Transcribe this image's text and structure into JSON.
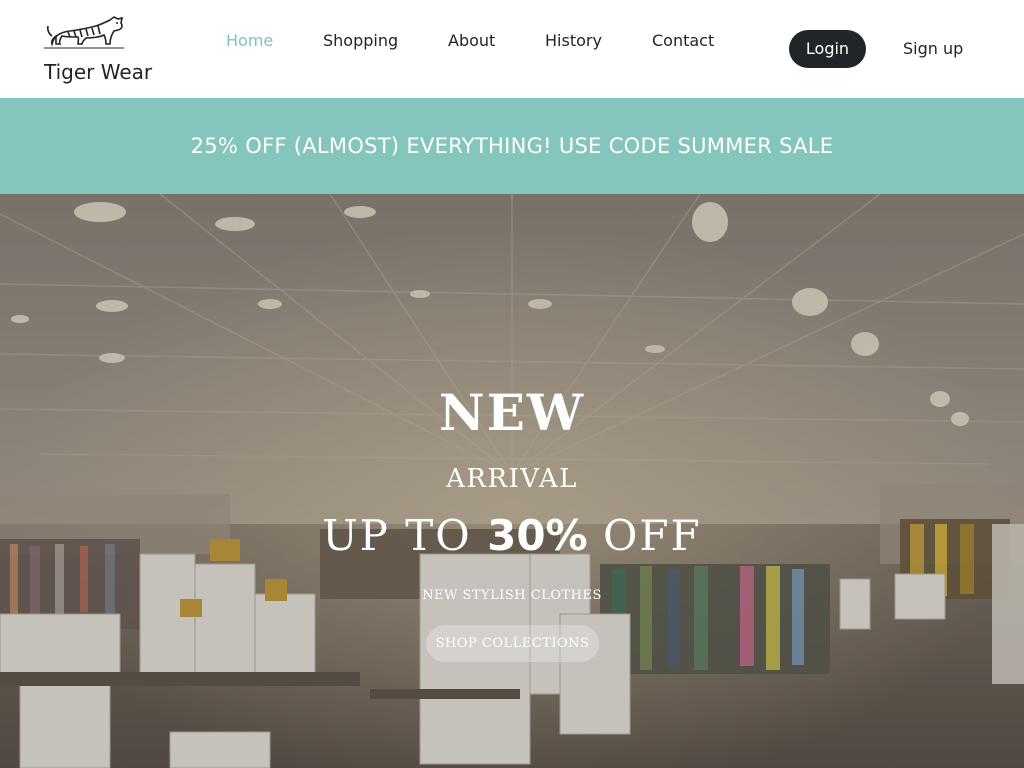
{
  "header": {
    "brand": {
      "name": "Tiger Wear",
      "logo_icon": "tiger-icon"
    },
    "nav": [
      {
        "label": "Home",
        "active": true
      },
      {
        "label": "Shopping",
        "active": false
      },
      {
        "label": "About",
        "active": false
      },
      {
        "label": "History",
        "active": false
      },
      {
        "label": "Contact",
        "active": false
      }
    ],
    "login_label": "Login",
    "signup_label": "Sign up"
  },
  "promo": {
    "text": "25% OFF (ALMOST) EVERYTHING! USE CODE SUMMER SALE"
  },
  "hero": {
    "headline": "NEW",
    "subheadline": "ARRIVAL",
    "offer_prefix": "UP TO",
    "offer_percent": "30%",
    "offer_suffix": "OFF",
    "tagline": "NEW STYLISH CLOTHES",
    "cta_label": "SHOP COLLECTIONS"
  },
  "colors": {
    "accent": "#84c6bb",
    "active_nav": "#7fc5ba",
    "dark": "#212529",
    "white": "#ffffff"
  }
}
